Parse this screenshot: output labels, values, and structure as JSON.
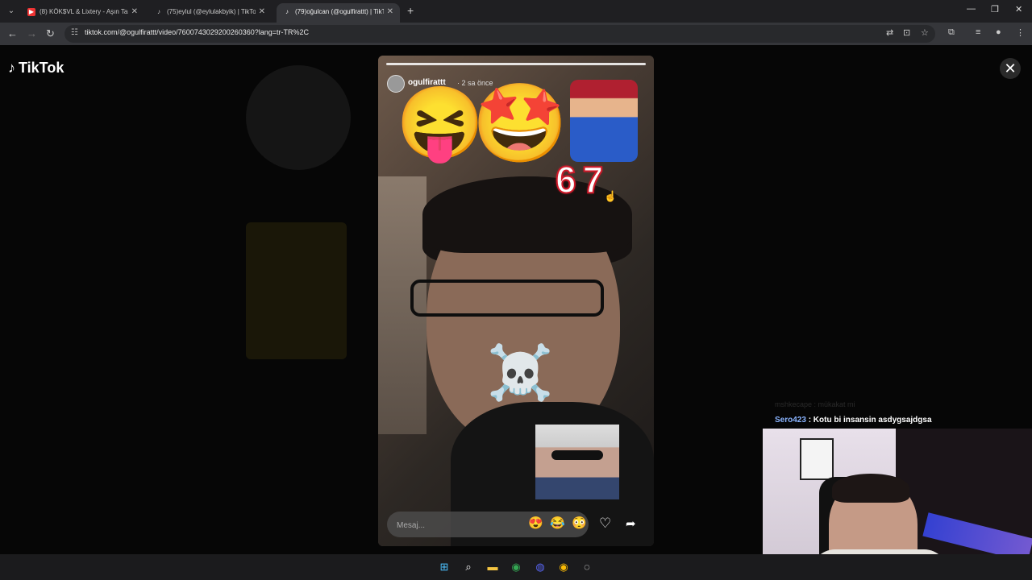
{
  "browser": {
    "tabs": [
      {
        "title": "(8) KÖK$VL & Lixtery - Aşın Tar",
        "favicon": "youtube-icon",
        "active": false
      },
      {
        "title": "(75)eylul (@eylulakbyik) | TikTok",
        "favicon": "tiktok-icon",
        "active": false
      },
      {
        "title": "(79)oğulcan (@ogulfirattt) | TikT",
        "favicon": "tiktok-icon",
        "active": true
      }
    ],
    "url": "tiktok.com/@ogulfirattt/video/7600743029200260360?lang=tr-TR%2C"
  },
  "tiktok": {
    "logo_text": "TikTok",
    "story": {
      "username": "ogulfirattt",
      "time_ago": "· 2 sa önce",
      "sticker_text": "67",
      "emoji_left": "😝",
      "emoji_star": "🤩",
      "emoji_skull": "☠️",
      "message_placeholder": "Mesaj...",
      "quick_reactions": [
        "😍",
        "😂",
        "😳"
      ]
    }
  },
  "stream_overlay": {
    "chat_ghost": "mshkecape : mükakat mi",
    "chat_user": "Sero423",
    "chat_message": " : Kotu bi insansin asdygsajdgsa"
  },
  "taskbar": {
    "icons": [
      "windows-start-icon",
      "search-icon",
      "file-explorer-icon",
      "chrome-icon",
      "discord-icon",
      "chrome-icon",
      "obs-icon"
    ]
  }
}
